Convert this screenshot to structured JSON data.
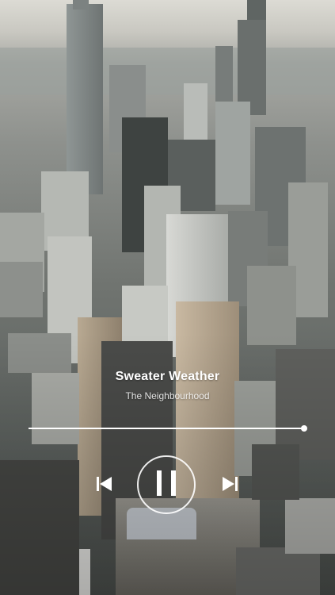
{
  "player": {
    "track_title": "Sweater Weather",
    "artist": "The Neighbourhood",
    "progress": 1.0,
    "state": "playing"
  },
  "controls": {
    "previous_icon": "skip-previous-icon",
    "play_pause_icon": "pause-icon",
    "next_icon": "skip-next-icon"
  },
  "colors": {
    "text_primary": "#ffffff",
    "progress_track": "#ffffff"
  }
}
